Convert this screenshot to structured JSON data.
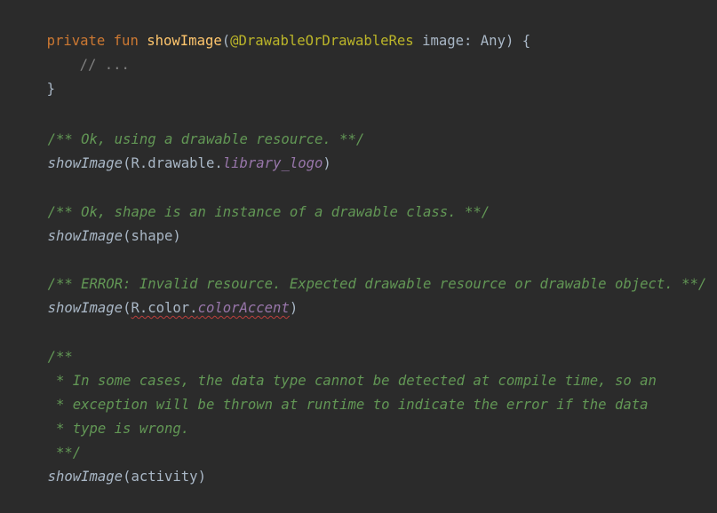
{
  "code": {
    "l1": {
      "kw_private": "private",
      "kw_fun": "fun",
      "fn_name": "showImage",
      "open_paren": "(",
      "annotation": "@DrawableOrDrawableRes",
      "param": "image",
      "colon": ":",
      "type": "Any",
      "close_paren": ")",
      "brace": "{"
    },
    "l2": {
      "comment": "// ..."
    },
    "l3": {
      "brace": "}"
    },
    "l5": {
      "comment": "/** Ok, using a drawable resource. **/"
    },
    "l6": {
      "call": "showImage",
      "open": "(",
      "receiver": "R.drawable.",
      "field": "library_logo",
      "close": ")"
    },
    "l8": {
      "comment": "/** Ok, shape is an instance of a drawable class. **/"
    },
    "l9": {
      "call": "showImage",
      "open": "(",
      "arg": "shape",
      "close": ")"
    },
    "l11": {
      "comment": "/** ERROR: Invalid resource. Expected drawable resource or drawable object. **/"
    },
    "l12": {
      "call": "showImage",
      "open": "(",
      "receiver": "R.color.",
      "field": "colorAccent",
      "close": ")"
    },
    "l14": {
      "comment": "/**"
    },
    "l15": {
      "comment": " * In some cases, the data type cannot be detected at compile time, so an"
    },
    "l16": {
      "comment": " * exception will be thrown at runtime to indicate the error if the data"
    },
    "l17": {
      "comment": " * type is wrong."
    },
    "l18": {
      "comment": " **/"
    },
    "l19": {
      "call": "showImage",
      "open": "(",
      "arg": "activity",
      "close": ")"
    }
  }
}
